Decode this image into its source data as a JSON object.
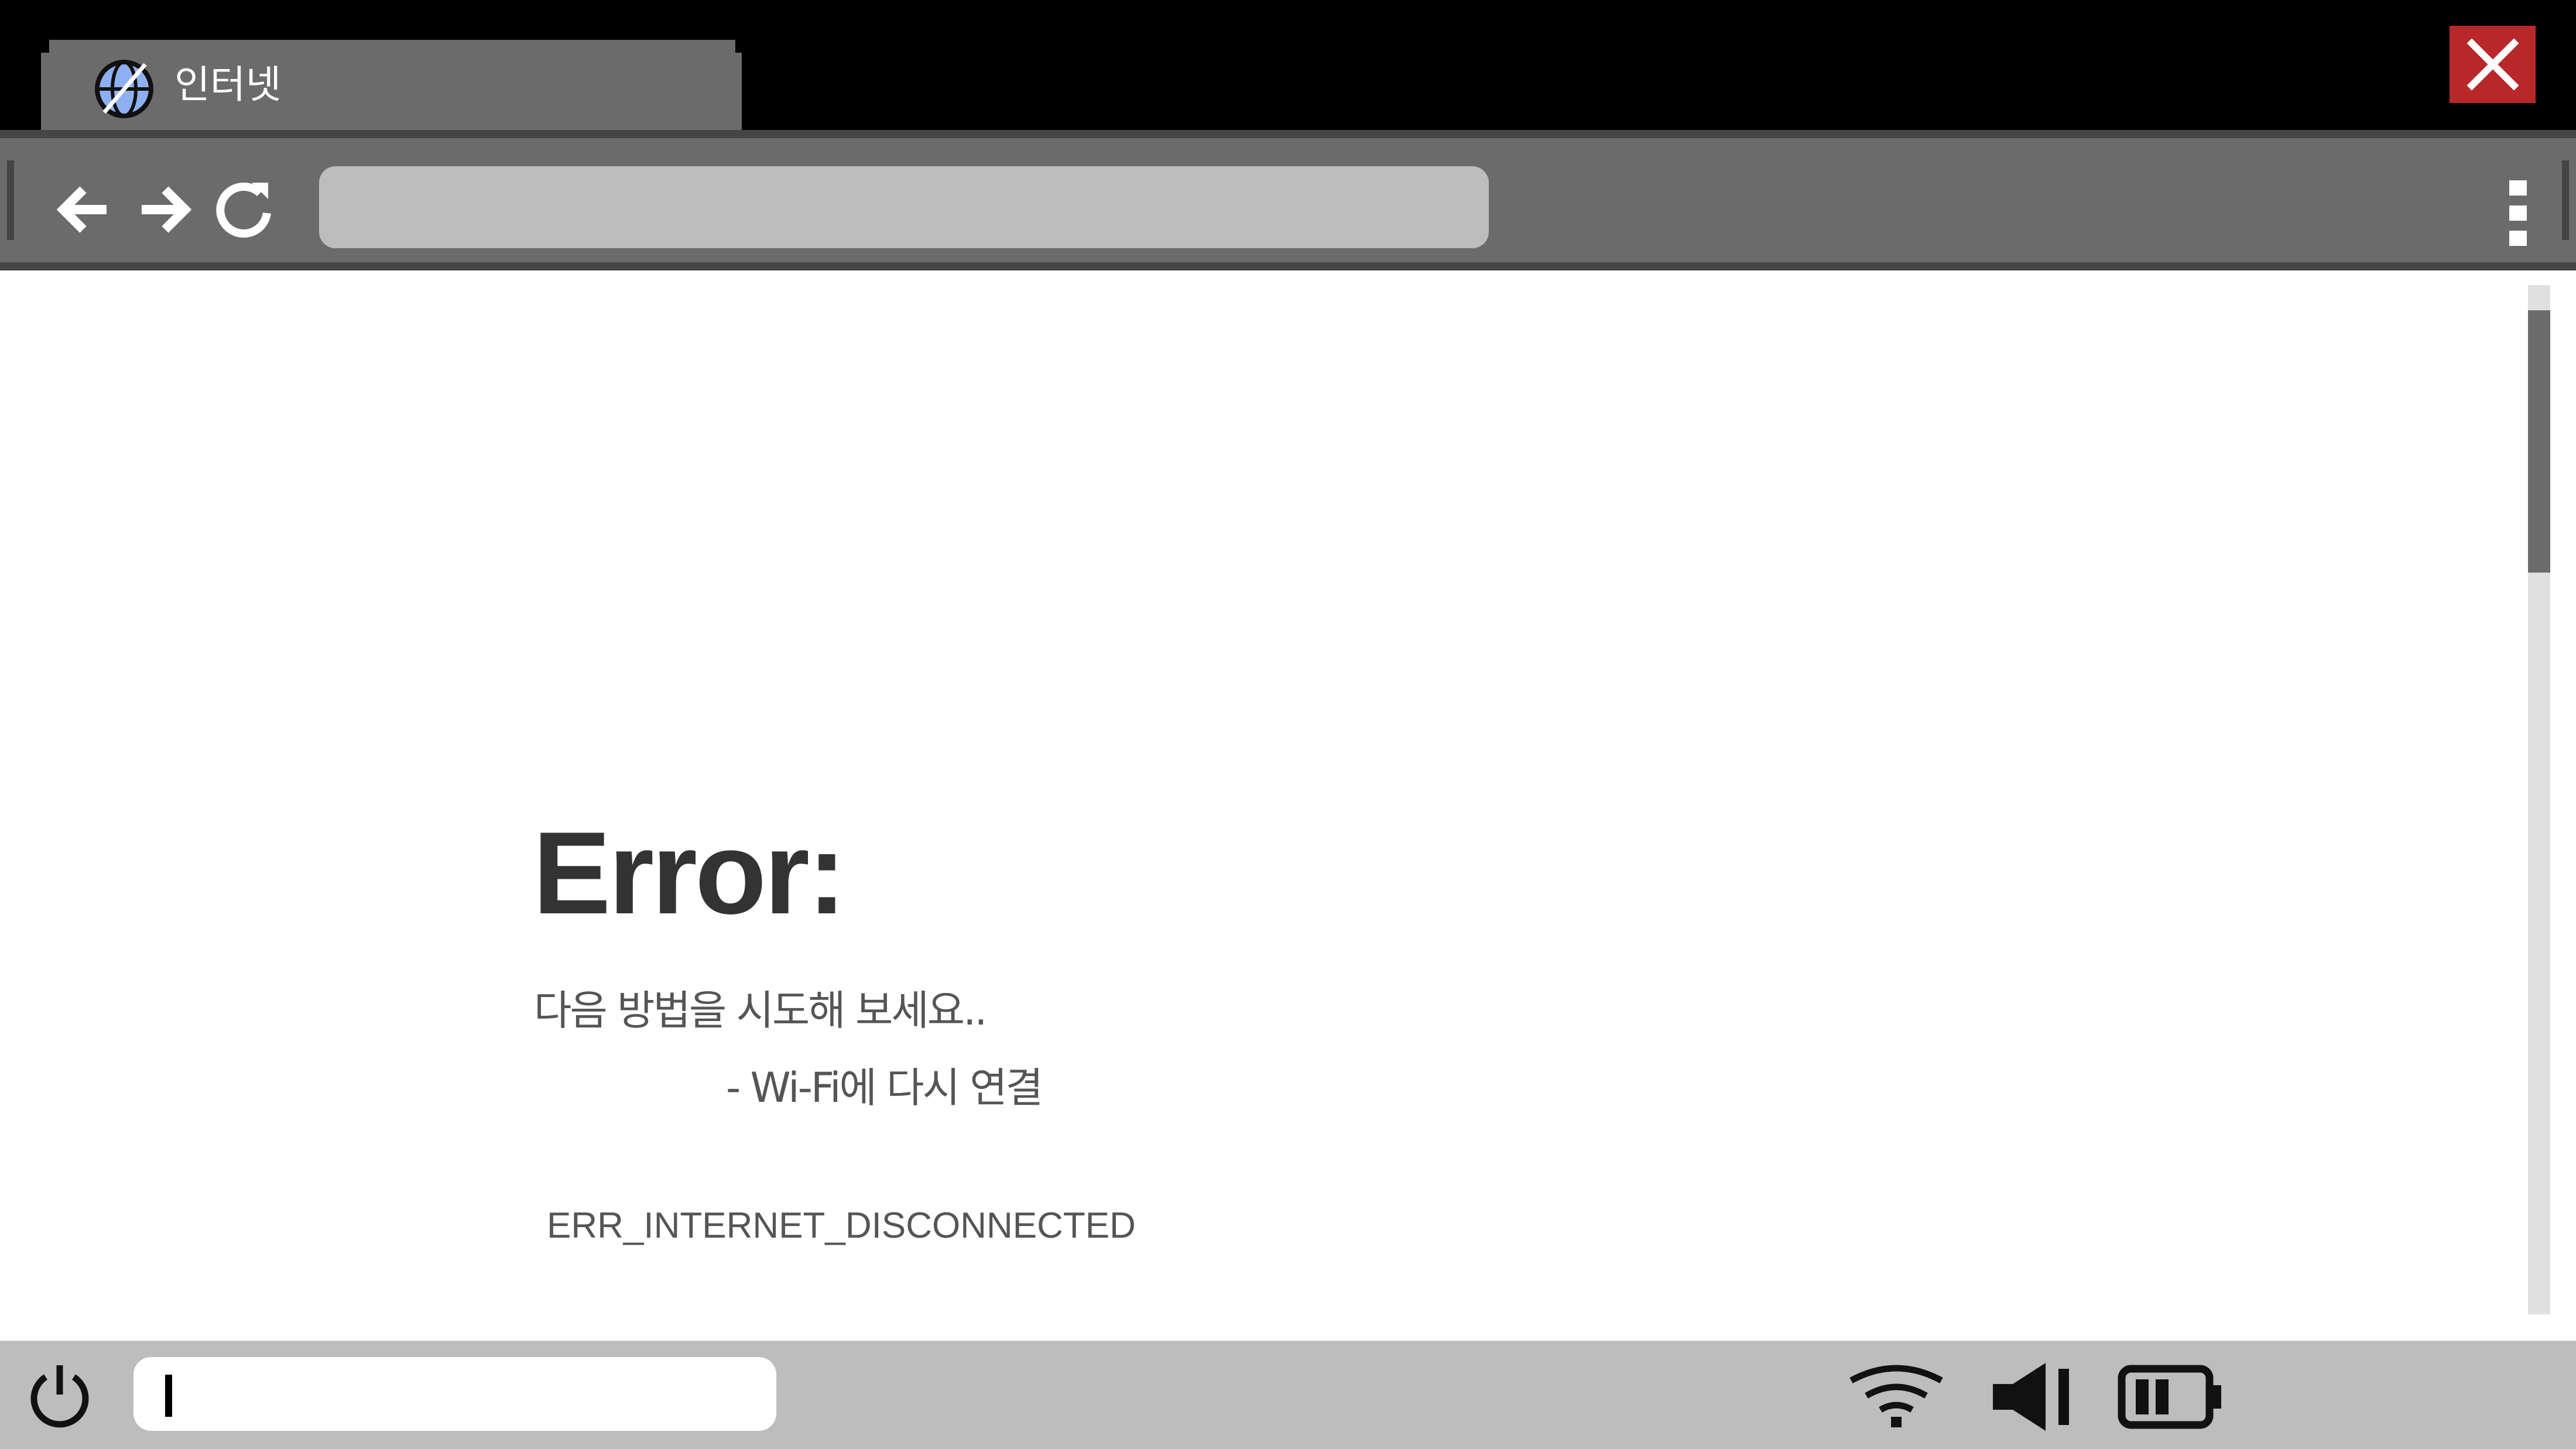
{
  "browser": {
    "tab": {
      "title": "인터넷",
      "icon": "globe-icon"
    },
    "close_icon": "close-icon",
    "close_color": "#b8282a",
    "toolbar": {
      "back_icon": "arrow-left-icon",
      "forward_icon": "arrow-right-icon",
      "reload_icon": "reload-icon",
      "menu_icon": "kebab-menu-icon",
      "address_value": ""
    }
  },
  "page": {
    "error_title": "Error:",
    "suggestion_intro": "다음 방법을 시도해 보세요..",
    "suggestion_item": "- Wi-Fi에 다시 연결",
    "error_code": "ERR_INTERNET_DISCONNECTED"
  },
  "taskbar": {
    "power_icon": "power-icon",
    "input_value": "",
    "tray": [
      "wifi-icon",
      "volume-icon",
      "battery-icon"
    ],
    "battery_level": 0.5
  },
  "colors": {
    "chrome_gray": "#6b6b6b",
    "dark_border": "#454545",
    "address_bar": "#bdbdbd",
    "taskbar": "#bdbdbd",
    "text": "#333333"
  }
}
